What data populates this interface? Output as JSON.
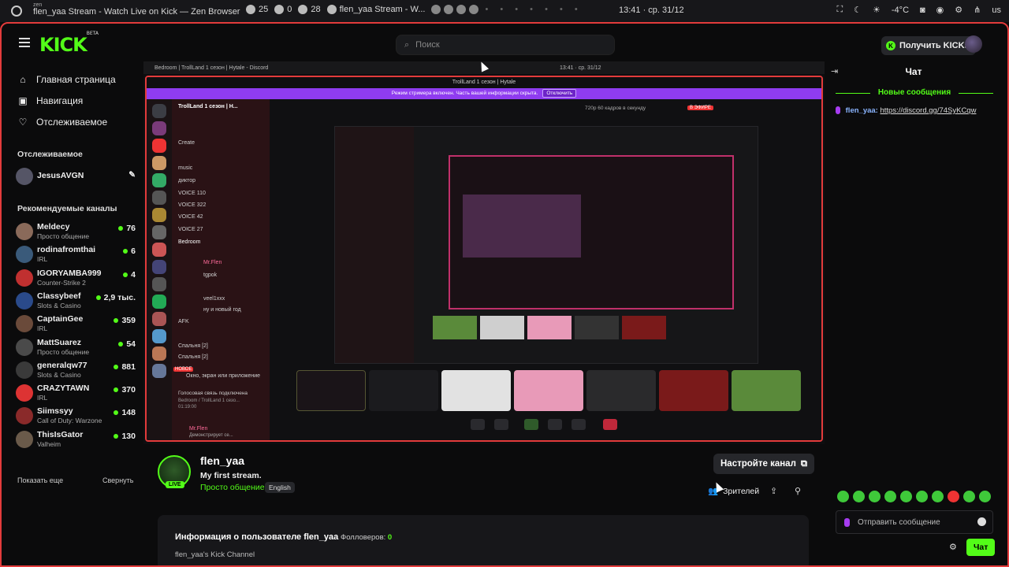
{
  "os": {
    "zen_label": "zen",
    "window_title": "flen_yaa Stream - Watch Live on Kick — Zen Browser",
    "ws1": "25",
    "ws2": "0",
    "ws3": "28",
    "task_label": "flen_yaa Stream - W...",
    "clock": "13:41 · ср. 31/12",
    "temperature": "-4°C",
    "lang": "us"
  },
  "header": {
    "logo": "KICK",
    "logo_badge": "BETA",
    "search_placeholder": "Поиск",
    "get_kicks": "Получить KICKs",
    "kicks_badge": "K"
  },
  "sidebar": {
    "nav": [
      {
        "label": "Главная страница",
        "icon": "home-icon"
      },
      {
        "label": "Навигация",
        "icon": "browse-icon"
      },
      {
        "label": "Отслеживаемое",
        "icon": "heart-icon"
      }
    ],
    "following_title": "Отслеживаемое",
    "following": [
      {
        "name": "JesusAVGN"
      }
    ],
    "recommended_title": "Рекомендуемые каналы",
    "channels": [
      {
        "name": "Meldecy",
        "category": "Просто общение",
        "viewers": "76",
        "color": "#8a6a5a"
      },
      {
        "name": "rodinafromthai",
        "category": "IRL",
        "viewers": "6",
        "color": "#3a5a7a"
      },
      {
        "name": "IGORYAMBA999",
        "category": "Counter-Strike 2",
        "viewers": "4",
        "color": "#c03030"
      },
      {
        "name": "Classybeef",
        "category": "Slots & Casino",
        "viewers": "2,9 тыс.",
        "color": "#2a4a8a"
      },
      {
        "name": "CaptainGee",
        "category": "IRL",
        "viewers": "359",
        "color": "#6a4a3a"
      },
      {
        "name": "MattSuarez",
        "category": "Просто общение",
        "viewers": "54",
        "color": "#4a4a4a"
      },
      {
        "name": "generalqw77",
        "category": "Slots & Casino",
        "viewers": "881",
        "color": "#3a3a3a"
      },
      {
        "name": "CRAZYTAWN",
        "category": "IRL",
        "viewers": "370",
        "color": "#d33"
      },
      {
        "name": "Siimssyy",
        "category": "Call of Duty: Warzone",
        "viewers": "148",
        "color": "#8a2a2a"
      },
      {
        "name": "ThisIsGator",
        "category": "Valheim",
        "viewers": "130",
        "color": "#6a5a4a"
      }
    ],
    "show_more": "Показать еще",
    "collapse": "Свернуть"
  },
  "player": {
    "inner_clock": "13:41 · ср. 31/12",
    "inner_task": "Bedroom | TrollLand 1 сезон | Hytale - Discord",
    "discord_title": "TrollLand 1 сезон | Hytale",
    "banner_text": "Режим стримера включен. Часть вашей информации скрыта.",
    "banner_button": "Отключить",
    "server_name": "TrollLand 1 сезон | H...",
    "voice_channels": [
      "Create",
      "music",
      "диктор",
      "VOICE 110",
      "VOICE 322",
      "VOICE 42",
      "VOICE 27",
      "Bedroom",
      "AFK",
      "Спальня [2]",
      "Спальня [2]"
    ],
    "voice_users": [
      "tgpok",
      "veel1xxx",
      "ну и новый год"
    ],
    "live_label": "В ЭФИРЕ",
    "quality": "720p 60 кадров в секунду",
    "share_title": "Окно, экран или приложение",
    "voice_status": "Голосовая связь подключена",
    "voice_sub": "Bedroom / TrollLand 1 сезо...",
    "call_time": "01:19:00",
    "new_label": "НОВОЕ",
    "self_user": "Mr.Flen",
    "self_status": "Демонстрирует се..."
  },
  "stream": {
    "streamer": "flen_yaa",
    "title": "My first stream.",
    "category": "Просто общение",
    "language": "English",
    "live_badge": "LIVE",
    "setup_button": "Настройте канал",
    "viewers_label": "Зрителей"
  },
  "about": {
    "heading": "Информация о пользователе flen_yaa",
    "followers_label": "Фолловеров:",
    "followers_count": "0",
    "description": "flen_yaa's Kick Channel"
  },
  "chat": {
    "title": "Чат",
    "new_messages": "Новые сообщения",
    "messages": [
      {
        "user": "flen_yaa:",
        "text": "https://discord.gg/74SyKCqw"
      }
    ],
    "input_placeholder": "Отправить сообщение",
    "send_button": "Чат"
  }
}
